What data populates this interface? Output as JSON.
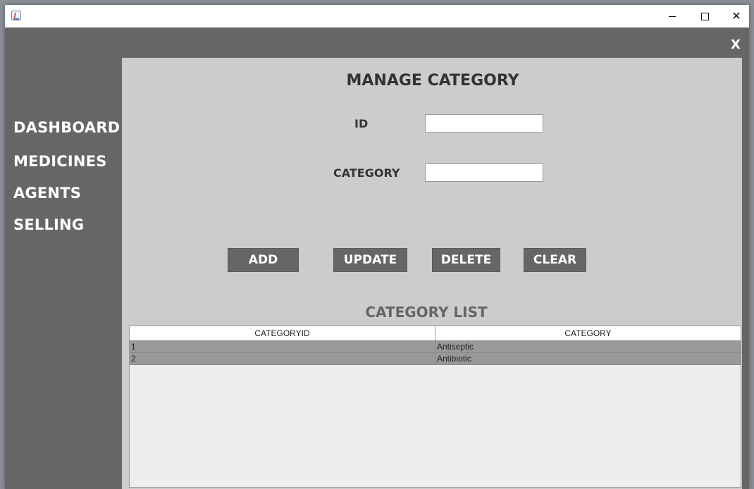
{
  "window": {
    "app_icon": "java-cup-icon",
    "controls": {
      "minimize": "minimize-icon",
      "maximize": "maximize-icon",
      "close": "close-icon"
    },
    "close_glyph": "✕"
  },
  "app": {
    "close_label": "X"
  },
  "sidebar": {
    "items": [
      {
        "label": "DASHBOARD"
      },
      {
        "label": "MEDICINES"
      },
      {
        "label": "AGENTS"
      },
      {
        "label": "SELLING"
      }
    ]
  },
  "main": {
    "title": "MANAGE CATEGORY",
    "form": {
      "id_label": "ID",
      "id_value": "",
      "category_label": "CATEGORY",
      "category_value": ""
    },
    "buttons": {
      "add": "ADD",
      "update": "UPDATE",
      "delete": "DELETE",
      "clear": "CLEAR"
    },
    "list_title": "CATEGORY LIST",
    "table": {
      "columns": [
        "CATEGORYID",
        "CATEGORY"
      ],
      "rows": [
        [
          "1",
          "Antiseptic"
        ],
        [
          "2",
          "Antibiotic"
        ]
      ]
    }
  },
  "colors": {
    "sidebar_bg": "#666666",
    "panel_bg": "#cccccc",
    "button_bg": "#666666",
    "row_bg": "#999999"
  }
}
